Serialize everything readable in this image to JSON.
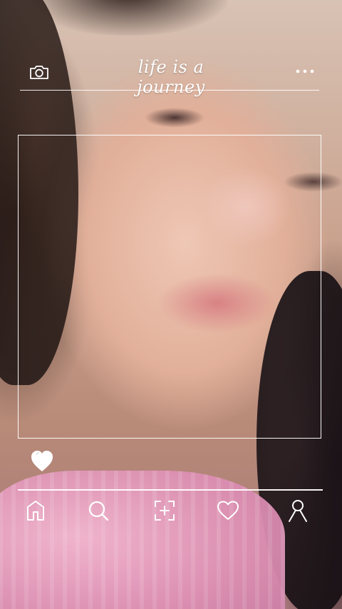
{
  "header": {
    "title": "life is a journey",
    "camera_icon": "camera-icon",
    "more_icon": "more-dots-icon"
  },
  "colors": {
    "overlay_stroke": "#ffffff",
    "shirt_pink": "#e79bbf",
    "skin": "#e8b8a2",
    "hair": "#1e1412"
  },
  "actions": {
    "like_icon": "heart-filled-icon"
  },
  "nav": {
    "items": [
      {
        "name": "home",
        "icon": "home-icon"
      },
      {
        "name": "search",
        "icon": "search-icon"
      },
      {
        "name": "add",
        "icon": "add-post-icon"
      },
      {
        "name": "activity",
        "icon": "heart-outline-icon"
      },
      {
        "name": "profile",
        "icon": "profile-icon"
      }
    ]
  }
}
